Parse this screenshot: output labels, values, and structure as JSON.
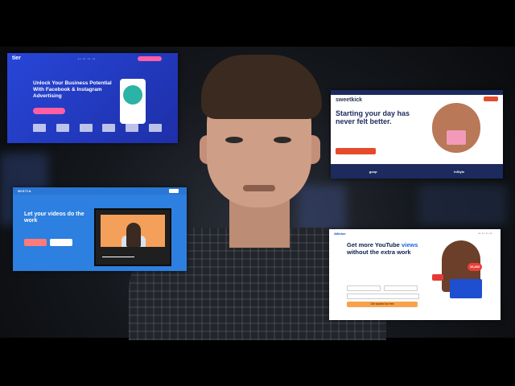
{
  "scene": "thumbnail",
  "cards": {
    "tier": {
      "logo": "tier",
      "headline": "Unlock Your Business Potential With Facebook & Instagram Advertising",
      "accent": "#2746d8"
    },
    "sweetkick": {
      "logo": "sweetkick",
      "headline": "Starting your day has never felt better.",
      "press": [
        "goop",
        "InStyle"
      ],
      "accent": "#1c2a5e"
    },
    "wistia": {
      "logo": "WISTIA",
      "headline": "Let your videos do the work",
      "accent": "#2d7fe0"
    },
    "aweber": {
      "logo": "AWeber",
      "headline_part1": "Get more YouTube",
      "headline_part2": "views",
      "headline_part3": "without the extra work",
      "cta": "Get started for free",
      "badge": "10,402",
      "accent": "#1a62e8"
    }
  },
  "colors": {
    "background": "#0c0e12",
    "skin": "#cf9e86",
    "hair": "#3b2a1f",
    "shirt": "#22262c"
  }
}
